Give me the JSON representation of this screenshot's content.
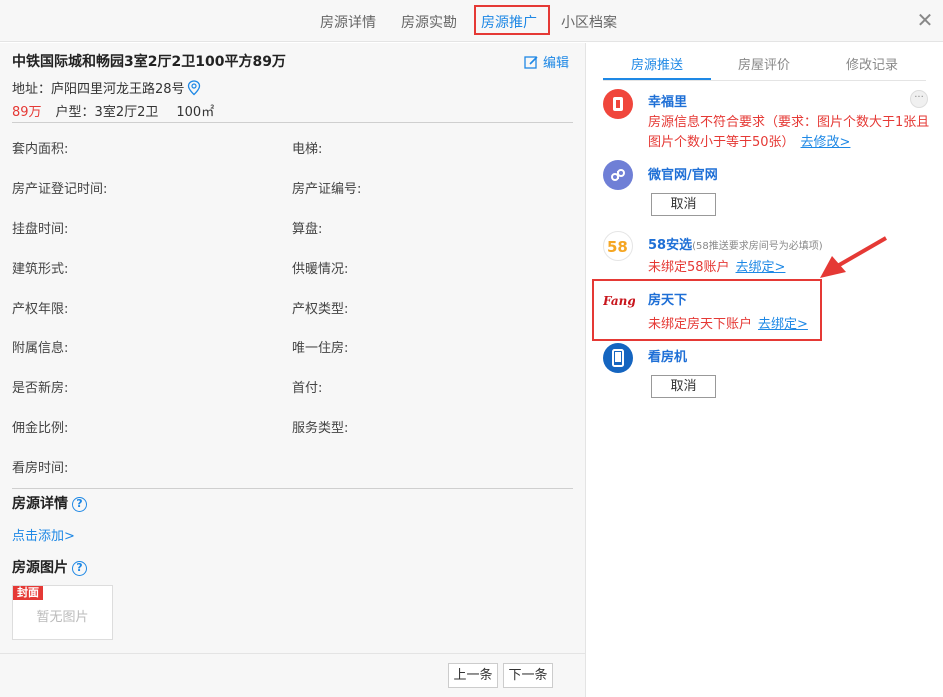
{
  "top_tabs": [
    {
      "label": "房源详情",
      "active": false
    },
    {
      "label": "房源实勘",
      "active": false
    },
    {
      "label": "房源推广",
      "active": true
    },
    {
      "label": "小区档案",
      "active": false
    }
  ],
  "close_icon": "close-icon",
  "house": {
    "title": "中铁国际城和畅园3室2厅2卫100平方89万",
    "edit_label": "编辑",
    "address": "地址：庐阳四里河龙王路28号",
    "price": "89万",
    "layout": "户型：3室2厅2卫",
    "area": "100㎡"
  },
  "fields": [
    "套内面积:",
    "电梯:",
    "房产证登记时间:",
    "房产证编号:",
    "挂盘时间:",
    "算盘:",
    "建筑形式:",
    "供暖情况:",
    "产权年限:",
    "产权类型:",
    "附属信息:",
    "唯一住房:",
    "是否新房:",
    "首付:",
    "佣金比例:",
    "服务类型:",
    "看房时间:"
  ],
  "detail_section": {
    "title": "房源详情",
    "add_link": "点击添加>"
  },
  "photo_section": {
    "title": "房源图片",
    "cover_label": "封面",
    "empty_text": "暂无图片"
  },
  "pager": {
    "prev": "上一条",
    "next": "下一条"
  },
  "right_tabs": [
    {
      "label": "房源推送",
      "active": true
    },
    {
      "label": "房屋评价",
      "active": false
    },
    {
      "label": "修改记录",
      "active": false
    }
  ],
  "channels": {
    "xingfuli": {
      "name": "幸福里",
      "error": "房源信息不符合要求（要求：图片个数大于1张且图片个数小于等于50张）",
      "link": "去修改>",
      "color": "#f0463c"
    },
    "weiguanwang": {
      "name": "微官网/官网",
      "button": "取消",
      "color": "#6f7fd6"
    },
    "anxuan58": {
      "name": "58安选",
      "note": "(58推送要求房间号为必填项)",
      "error": "未绑定58账户",
      "link": "去绑定>",
      "logo_text": "58"
    },
    "fangtianxia": {
      "name": "房天下",
      "error": "未绑定房天下账户",
      "link": "去绑定>",
      "logo_text": "Fang",
      "color": "#c8161d"
    },
    "kanfangji": {
      "name": "看房机",
      "button": "取消",
      "color": "#1565c0"
    }
  },
  "more_label": "···",
  "help_mark": "?"
}
